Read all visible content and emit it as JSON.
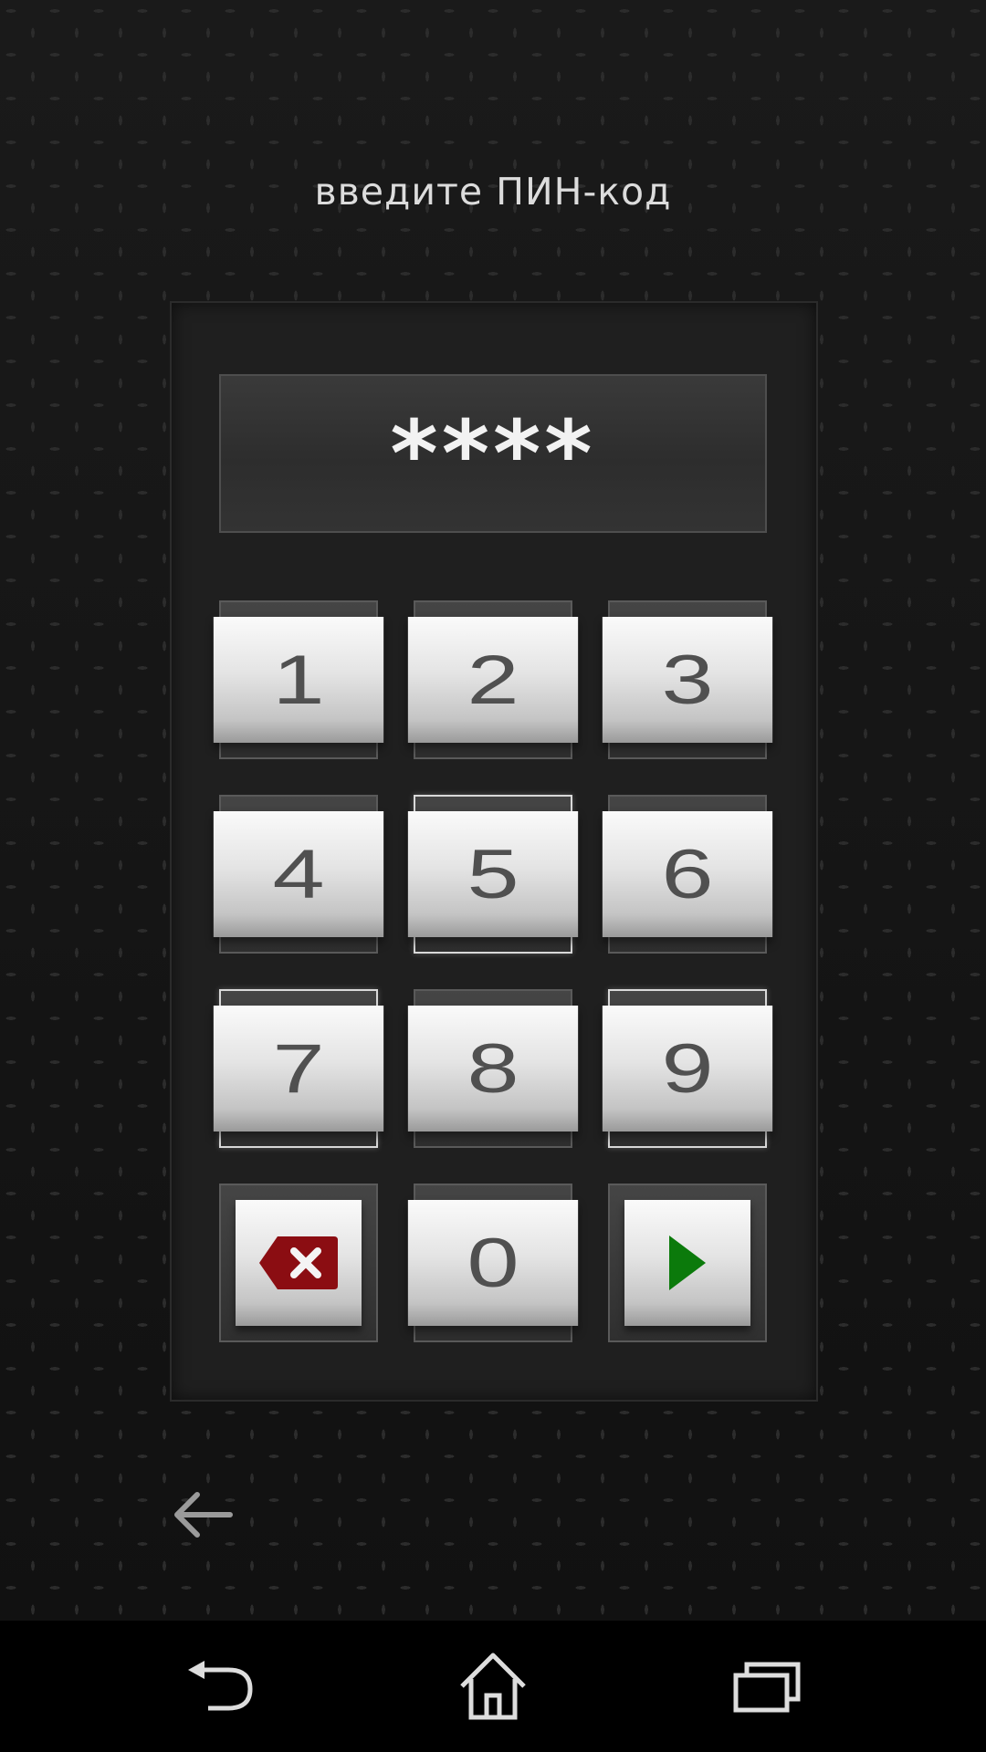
{
  "prompt": "введите ПИН-код",
  "pin_display": "****",
  "keys": [
    "1",
    "2",
    "3",
    "4",
    "5",
    "6",
    "7",
    "8",
    "9",
    "0"
  ],
  "icons": {
    "delete": "backspace-icon",
    "submit": "play-icon",
    "back": "arrow-left-icon",
    "nav_back": "nav-back-icon",
    "nav_home": "nav-home-icon",
    "nav_recents": "nav-recents-icon"
  },
  "colors": {
    "delete": "#8b0d12",
    "submit": "#0b7a0b"
  }
}
